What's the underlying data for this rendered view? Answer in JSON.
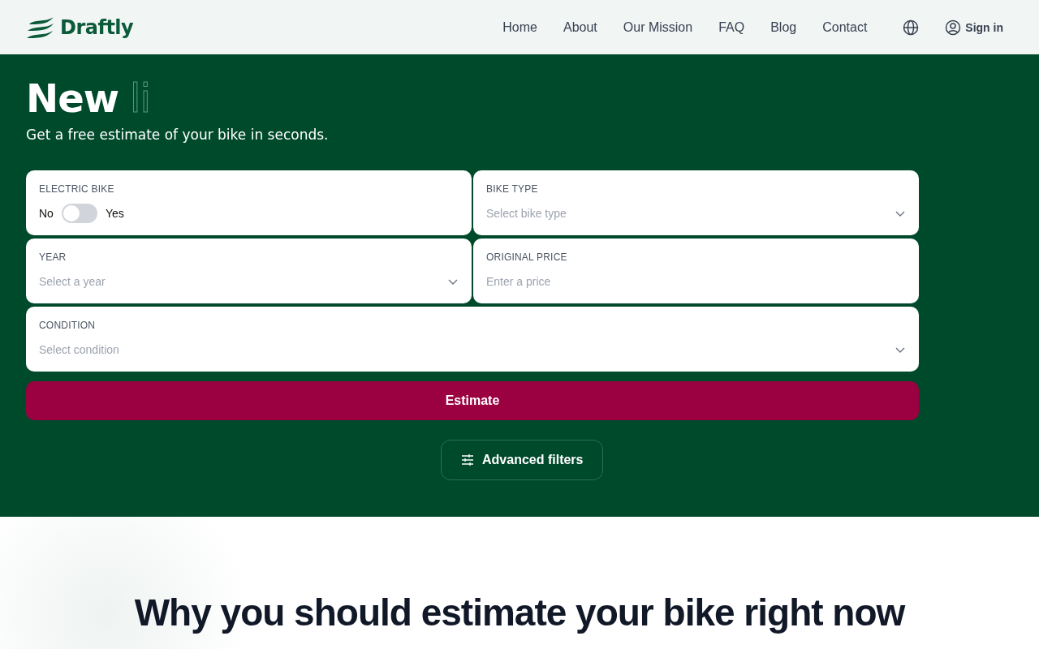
{
  "header": {
    "logo": "Draftly",
    "nav": [
      {
        "label": "Home"
      },
      {
        "label": "About"
      },
      {
        "label": "Our Mission"
      },
      {
        "label": "FAQ"
      },
      {
        "label": "Blog"
      },
      {
        "label": "Contact"
      }
    ],
    "sign_in": "Sign in"
  },
  "hero": {
    "title": "New",
    "title_typing": "li",
    "subtitle": "Get a free estimate of your bike in seconds.",
    "fields": [
      {
        "kind": "toggle",
        "label": "ELECTRIC BIKE",
        "off_label": "No",
        "on_label": "Yes",
        "on": false
      },
      {
        "kind": "select",
        "label": "BIKE TYPE",
        "placeholder": "Select bike type"
      },
      {
        "kind": "select",
        "label": "YEAR",
        "placeholder": "Select a year"
      },
      {
        "kind": "input",
        "label": "ORIGINAL PRICE",
        "placeholder": "Enter a price"
      },
      {
        "kind": "select",
        "label": "CONDITION",
        "placeholder": "Select condition"
      }
    ],
    "submit": "Estimate",
    "advanced": "Advanced filters"
  },
  "section": {
    "heading": "Why you should estimate your bike right now"
  }
}
